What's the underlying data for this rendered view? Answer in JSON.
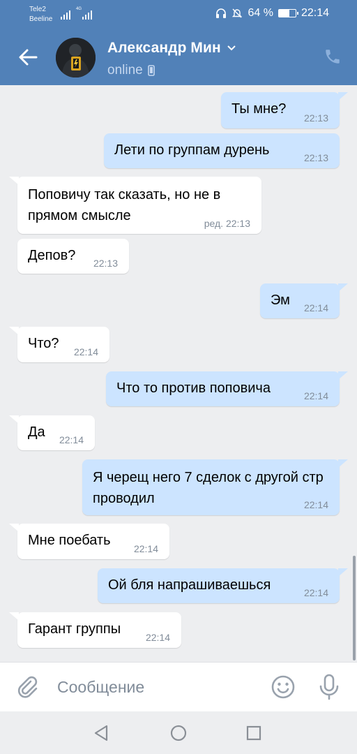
{
  "status_bar": {
    "carrier_1": "Tele2",
    "carrier_2": "Beeline",
    "network": "4G",
    "battery_percent": "64 %",
    "battery_level": 0.64,
    "time": "22:14"
  },
  "header": {
    "contact_name": "Александр Мин",
    "presence": "online"
  },
  "messages": [
    {
      "side": "out",
      "text": "Ты мне?",
      "time": "22:13"
    },
    {
      "side": "out",
      "text": "Лети по группам дурень",
      "time": "22:13"
    },
    {
      "side": "in",
      "text": "Поповичу так сказать, но не в прямом смысле",
      "time": "ред. 22:13"
    },
    {
      "side": "in",
      "text": "Депов?",
      "time": "22:13"
    },
    {
      "side": "out",
      "text": "Эм",
      "time": "22:14"
    },
    {
      "side": "in",
      "text": "Что?",
      "time": "22:14"
    },
    {
      "side": "out",
      "text": "Что то против поповича",
      "time": "22:14"
    },
    {
      "side": "in",
      "text": "Да",
      "time": "22:14"
    },
    {
      "side": "out",
      "text": "Я черещ него 7 сделок с другой стр проводил",
      "time": "22:14"
    },
    {
      "side": "in",
      "text": "Мне поебать",
      "time": "22:14"
    },
    {
      "side": "out",
      "text": "Ой бля напрашиваешься",
      "time": "22:14"
    },
    {
      "side": "in",
      "text": "Гарант группы",
      "time": "22:14"
    }
  ],
  "composer": {
    "placeholder": "Сообщение"
  },
  "icons": {
    "back": "arrow-left-icon",
    "phone": "phone-icon",
    "attach": "paperclip-icon",
    "emoji": "smile-icon",
    "mic": "microphone-icon"
  },
  "colors": {
    "header": "#5181b8",
    "chat_background": "#edeef0",
    "outgoing_bubble": "#cce4ff",
    "incoming_bubble": "#ffffff",
    "time_text": "#818c99"
  }
}
